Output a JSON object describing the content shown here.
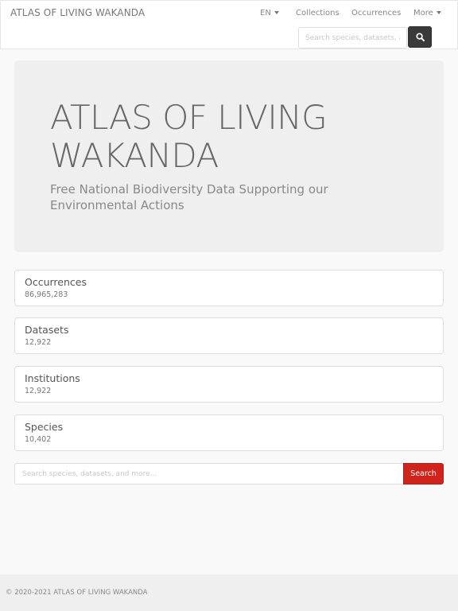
{
  "navbar": {
    "brand": "ATLAS OF LIVING WAKANDA",
    "language": "EN",
    "links": [
      "Collections",
      "Occurrences",
      "More"
    ],
    "search_placeholder": "Search species, datasets, a",
    "search_icon": "search-icon"
  },
  "hero": {
    "title": "ATLAS OF LIVING WAKANDA",
    "subtitle": "Free National Biodiversity Data Supporting our Environmental Actions"
  },
  "stats": [
    {
      "label": "Occurrences",
      "value": "86,965,283"
    },
    {
      "label": "Datasets",
      "value": "12,922"
    },
    {
      "label": "Institutions",
      "value": "12,922"
    },
    {
      "label": "Species",
      "value": "10,402"
    }
  ],
  "main_search": {
    "placeholder": "Search species, datasets, and more...",
    "button_label": "Search",
    "button_color": "#d0231c"
  },
  "footer": {
    "text": "© 2020-2021 ATLAS OF LIVING WAKANDA"
  }
}
